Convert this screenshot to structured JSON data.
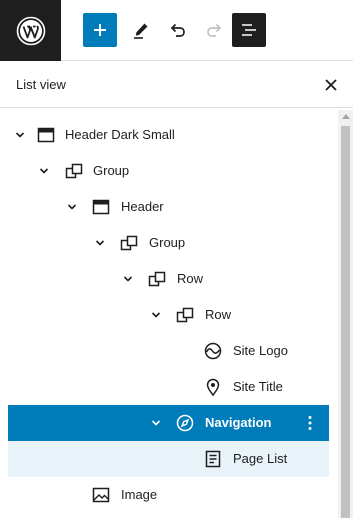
{
  "toolbar": {
    "logo_icon": "wordpress-logo-icon",
    "add_icon": "plus-icon",
    "edit_icon": "pencil-icon",
    "undo_icon": "undo-icon",
    "redo_icon": "redo-icon",
    "list_view_icon": "list-view-icon",
    "accent": "#007cba"
  },
  "panel": {
    "title": "List view",
    "close_icon": "close-icon"
  },
  "tree": [
    {
      "label": "Header Dark Small",
      "icon": "template-part-icon",
      "expanded": true,
      "level": 1
    },
    {
      "label": "Group",
      "icon": "group-icon",
      "expanded": true,
      "level": 2
    },
    {
      "label": "Header",
      "icon": "template-part-icon",
      "expanded": true,
      "level": 3
    },
    {
      "label": "Group",
      "icon": "group-icon",
      "expanded": true,
      "level": 4
    },
    {
      "label": "Row",
      "icon": "group-icon",
      "expanded": true,
      "level": 5
    },
    {
      "label": "Row",
      "icon": "group-icon",
      "expanded": true,
      "level": 6
    },
    {
      "label": "Site Logo",
      "icon": "site-logo-icon",
      "expanded": null,
      "level": 7
    },
    {
      "label": "Site Title",
      "icon": "map-marker-icon",
      "expanded": null,
      "level": 7
    },
    {
      "label": "Navigation",
      "icon": "navigation-icon",
      "expanded": true,
      "level": 7,
      "selected": true
    },
    {
      "label": "Page List",
      "icon": "page-list-icon",
      "expanded": null,
      "level": 8
    },
    {
      "label": "Image",
      "icon": "image-icon",
      "expanded": null,
      "level": 4
    }
  ]
}
